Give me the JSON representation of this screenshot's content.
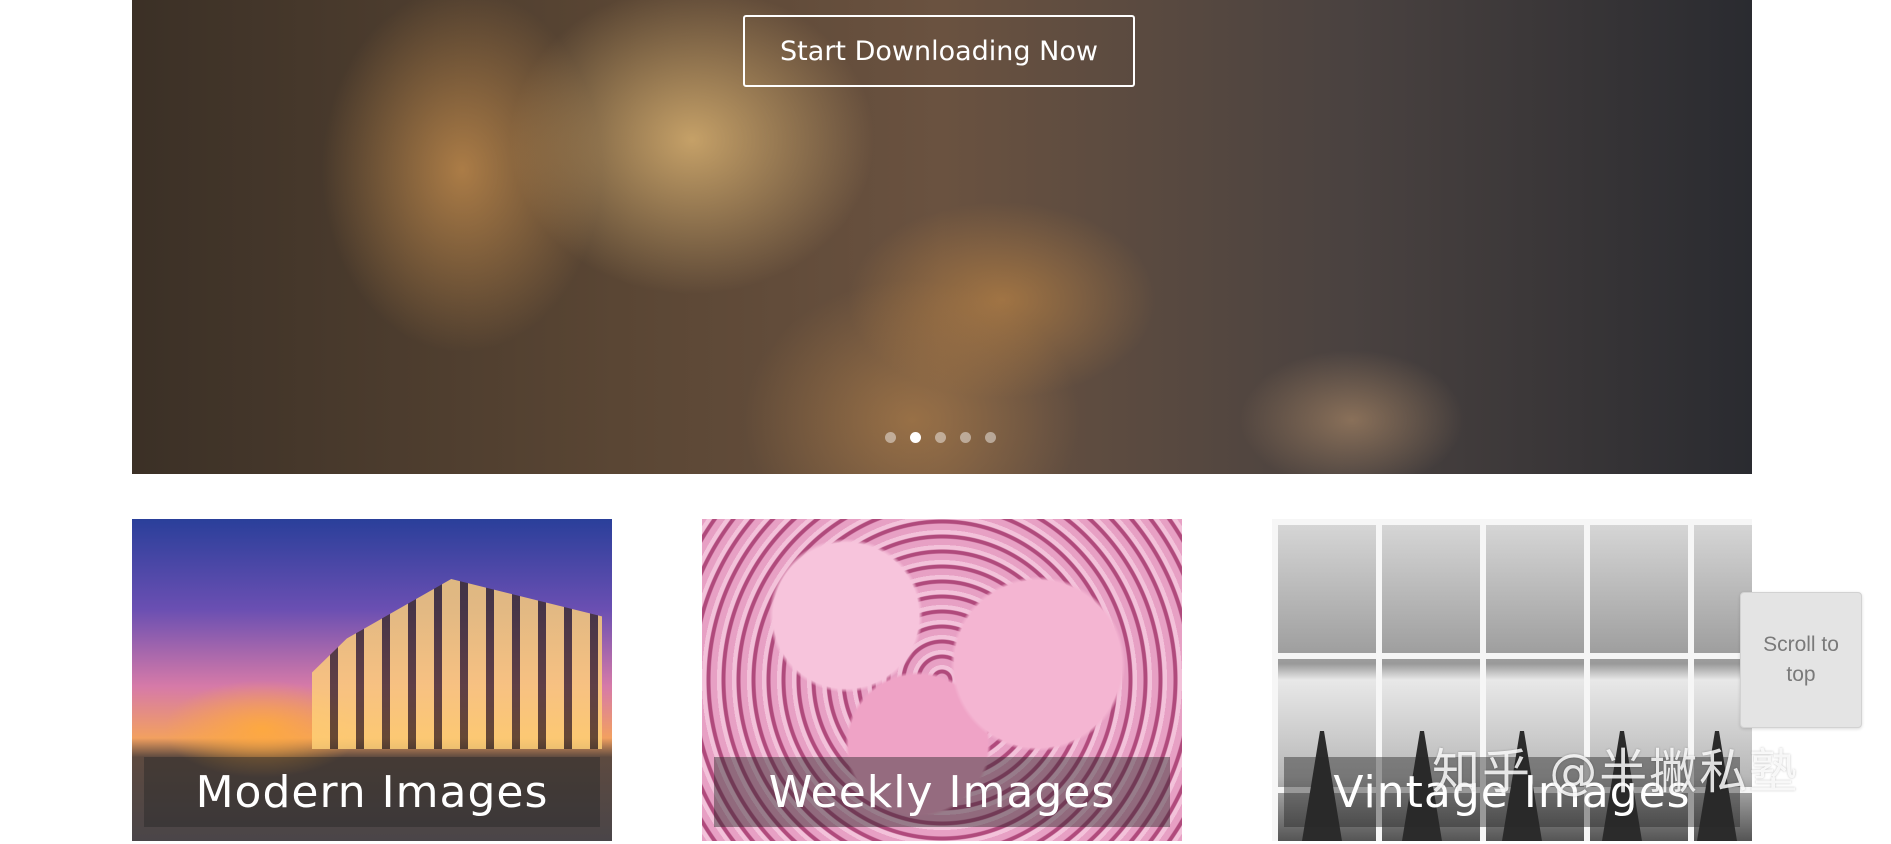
{
  "hero": {
    "cta_label": "Start Downloading Now",
    "slides": [
      {
        "active": false
      },
      {
        "active": true
      },
      {
        "active": false
      },
      {
        "active": false
      },
      {
        "active": false
      }
    ]
  },
  "categories": [
    {
      "label": "Modern Images"
    },
    {
      "label": "Weekly Images"
    },
    {
      "label": "Vintage Images"
    }
  ],
  "scroll_to_top": {
    "label": "Scroll to top"
  },
  "watermark": {
    "text": "知乎 @半撇私塾"
  }
}
